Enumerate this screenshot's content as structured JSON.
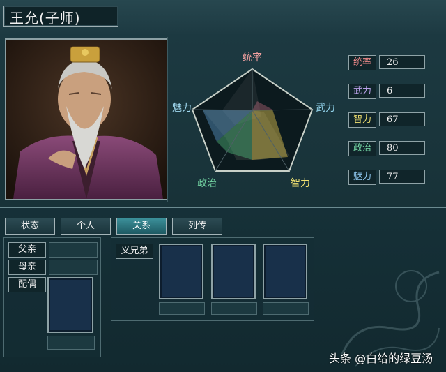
{
  "character": {
    "name": "王允(子师)"
  },
  "radar": {
    "labels": {
      "top": "统率",
      "right": "武力",
      "bottom_right": "智力",
      "bottom_left": "政治",
      "left": "魅力"
    },
    "colors": {
      "top": "#f0a0a0",
      "right": "#8fd0e8",
      "bottom_right": "#f0e070",
      "bottom_left": "#70d0a0",
      "left": "#a0d8f0"
    }
  },
  "stats": [
    {
      "label": "统率",
      "value": "26",
      "color": "#f08a8a"
    },
    {
      "label": "武力",
      "value": "6",
      "color": "#b9a0e8"
    },
    {
      "label": "智力",
      "value": "67",
      "color": "#f0e070"
    },
    {
      "label": "政治",
      "value": "80",
      "color": "#70d0a0"
    },
    {
      "label": "魅力",
      "value": "77",
      "color": "#8fc8f0"
    }
  ],
  "tabs": [
    {
      "label": "状态",
      "active": false
    },
    {
      "label": "个人",
      "active": false
    },
    {
      "label": "关系",
      "active": true
    },
    {
      "label": "列传",
      "active": false
    }
  ],
  "relations": {
    "father_label": "父亲",
    "mother_label": "母亲",
    "spouse_label": "配偶",
    "sworn_label": "义兄弟"
  },
  "watermark": "头条 @白给的绿豆汤"
}
